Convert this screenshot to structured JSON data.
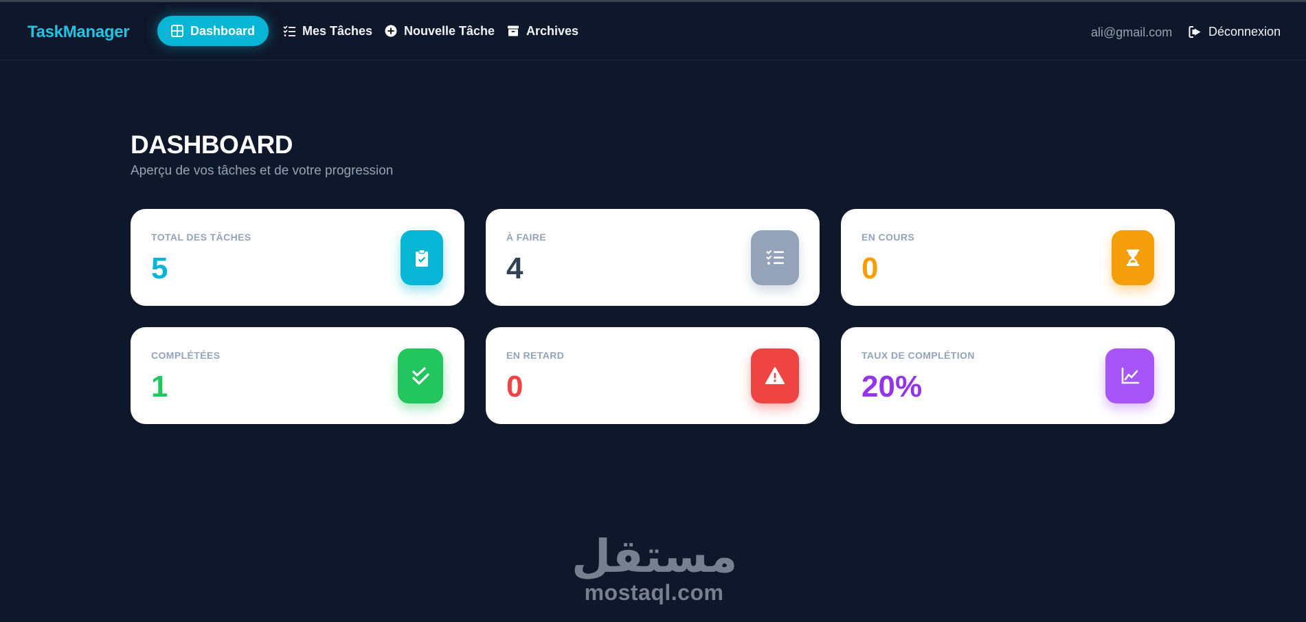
{
  "navbar": {
    "brand": "TaskManager",
    "items": [
      {
        "label": "Dashboard",
        "icon": "grid-icon",
        "active": true
      },
      {
        "label": "Mes Tâches",
        "icon": "list-check-icon",
        "active": false
      },
      {
        "label": "Nouvelle Tâche",
        "icon": "plus-circle-icon",
        "active": false
      },
      {
        "label": "Archives",
        "icon": "archive-icon",
        "active": false
      }
    ],
    "user_email": "ali@gmail.com",
    "logout_label": "Déconnexion",
    "logout_icon": "logout-icon"
  },
  "page": {
    "title": "DASHBOARD",
    "subtitle": "Aperçu de vos tâches et de votre progression"
  },
  "stats": [
    {
      "label": "TOTAL DES TÂCHES",
      "value": "5",
      "color": "#06b6d4",
      "icon": "clipboard-check-icon",
      "icon_bg": "#06b6d4"
    },
    {
      "label": "À FAIRE",
      "value": "4",
      "color": "#334155",
      "icon": "list-check-icon",
      "icon_bg": "#94a3b8"
    },
    {
      "label": "EN COURS",
      "value": "0",
      "color": "#f59e0b",
      "icon": "hourglass-icon",
      "icon_bg": "#f59e0b"
    },
    {
      "label": "COMPLÉTÉES",
      "value": "1",
      "color": "#22c55e",
      "icon": "double-check-icon",
      "icon_bg": "#22c55e"
    },
    {
      "label": "EN RETARD",
      "value": "0",
      "color": "#ef4444",
      "icon": "warning-icon",
      "icon_bg": "#ef4444"
    },
    {
      "label": "TAUX DE COMPLÉTION",
      "value": "20%",
      "color": "#9333ea",
      "icon": "line-chart-icon",
      "icon_bg": "#a855f7"
    }
  ],
  "watermark": {
    "arabic": "مستقل",
    "latin": "mostaql.com"
  }
}
